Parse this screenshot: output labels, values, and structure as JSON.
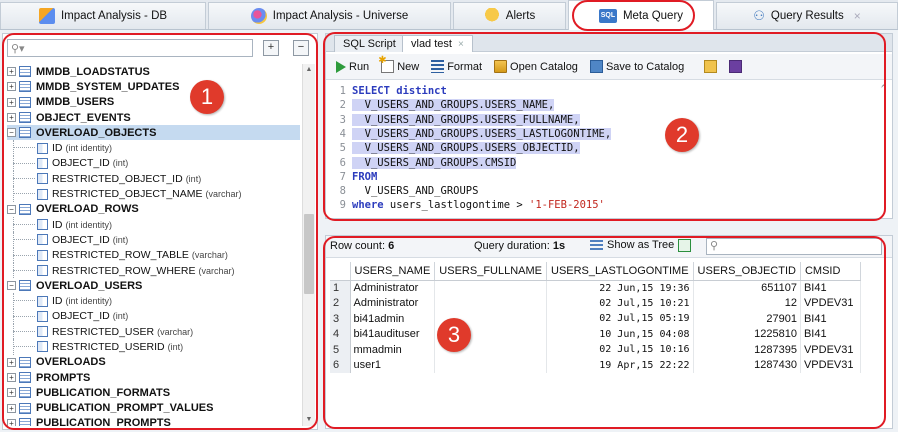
{
  "top_tabs": [
    {
      "label": "Impact Analysis - DB",
      "icon": "impact-analysis-icon"
    },
    {
      "label": "Impact Analysis - Universe",
      "icon": "universe-icon"
    },
    {
      "label": "Alerts",
      "icon": "bell-icon"
    },
    {
      "label": "Meta Query",
      "icon": "sql-icon",
      "icon_text": "SQL",
      "active": true
    },
    {
      "label": "Query Results",
      "icon": "results-icon",
      "close": "×"
    }
  ],
  "left": {
    "search_placeholder": "",
    "expand_all": "+",
    "collapse_all": "−",
    "tree": [
      {
        "type": "table",
        "name": "MMDB_LOADSTATUS"
      },
      {
        "type": "table",
        "name": "MMDB_SYSTEM_UPDATES"
      },
      {
        "type": "table",
        "name": "MMDB_USERS"
      },
      {
        "type": "table",
        "name": "OBJECT_EVENTS"
      },
      {
        "type": "table",
        "name": "OVERLOAD_OBJECTS",
        "selected": true,
        "expanded": true
      },
      {
        "type": "col",
        "name": "ID",
        "dtype": "(int identity)"
      },
      {
        "type": "col",
        "name": "OBJECT_ID",
        "dtype": "(int)"
      },
      {
        "type": "col",
        "name": "RESTRICTED_OBJECT_ID",
        "dtype": "(int)"
      },
      {
        "type": "col",
        "name": "RESTRICTED_OBJECT_NAME",
        "dtype": "(varchar)"
      },
      {
        "type": "table",
        "name": "OVERLOAD_ROWS",
        "expanded": true
      },
      {
        "type": "col",
        "name": "ID",
        "dtype": "(int identity)"
      },
      {
        "type": "col",
        "name": "OBJECT_ID",
        "dtype": "(int)"
      },
      {
        "type": "col",
        "name": "RESTRICTED_ROW_TABLE",
        "dtype": "(varchar)"
      },
      {
        "type": "col",
        "name": "RESTRICTED_ROW_WHERE",
        "dtype": "(varchar)"
      },
      {
        "type": "table",
        "name": "OVERLOAD_USERS",
        "expanded": true
      },
      {
        "type": "col",
        "name": "ID",
        "dtype": "(int identity)"
      },
      {
        "type": "col",
        "name": "OBJECT_ID",
        "dtype": "(int)"
      },
      {
        "type": "col",
        "name": "RESTRICTED_USER",
        "dtype": "(varchar)"
      },
      {
        "type": "col",
        "name": "RESTRICTED_USERID",
        "dtype": "(int)"
      },
      {
        "type": "table",
        "name": "OVERLOADS"
      },
      {
        "type": "table",
        "name": "PROMPTS"
      },
      {
        "type": "table",
        "name": "PUBLICATION_FORMATS"
      },
      {
        "type": "table",
        "name": "PUBLICATION_PROMPT_VALUES"
      },
      {
        "type": "table",
        "name": "PUBLICATION_PROMPTS"
      }
    ]
  },
  "editor": {
    "tabs": [
      {
        "label": "SQL Script",
        "active": false
      },
      {
        "label": "vlad test",
        "active": true,
        "close": "×"
      }
    ],
    "toolbar": {
      "run": "Run",
      "new": "New",
      "format": "Format",
      "open_catalog": "Open Catalog",
      "save_catalog": "Save to Catalog"
    },
    "lines": [
      {
        "n": "1",
        "text": "SELECT distinct",
        "kind": "kw"
      },
      {
        "n": "2",
        "text": "  V_USERS_AND_GROUPS.USERS_NAME,",
        "kind": "hl"
      },
      {
        "n": "3",
        "text": "  V_USERS_AND_GROUPS.USERS_FULLNAME,",
        "kind": "hl"
      },
      {
        "n": "4",
        "text": "  V_USERS_AND_GROUPS.USERS_LASTLOGONTIME,",
        "kind": "hl"
      },
      {
        "n": "5",
        "text": "  V_USERS_AND_GROUPS.USERS_OBJECTID,",
        "kind": "hl"
      },
      {
        "n": "6",
        "text": "  V_USERS_AND_GROUPS.CMSID",
        "kind": "hl"
      },
      {
        "n": "7",
        "text": "FROM",
        "kind": "kw"
      },
      {
        "n": "8",
        "text": "  V_USERS_AND_GROUPS",
        "kind": "plain"
      },
      {
        "n": "9",
        "kw": "where",
        "text": " users_lastlogontime > ",
        "str": "'1-FEB-2015'",
        "kind": "where"
      }
    ]
  },
  "results": {
    "row_count_label": "Row count:",
    "row_count": "6",
    "duration_label": "Query duration:",
    "duration": "1s",
    "show_tree": "Show as Tree",
    "search_placeholder": "",
    "columns": [
      "USERS_NAME",
      "USERS_FULLNAME",
      "USERS_LASTLOGONTIME",
      "USERS_OBJECTID",
      "CMSID"
    ],
    "rows": [
      [
        "1",
        "Administrator",
        "",
        "22 Jun,15 19:36",
        "651107",
        "BI41"
      ],
      [
        "2",
        "Administrator",
        "",
        "02 Jul,15 10:21",
        "12",
        "VPDEV31"
      ],
      [
        "3",
        "bi41admin",
        "",
        "02 Jul,15 05:19",
        "27901",
        "BI41"
      ],
      [
        "4",
        "bi41audituser",
        "",
        "10 Jun,15 04:08",
        "1225810",
        "BI41"
      ],
      [
        "5",
        "mmadmin",
        "",
        "02 Jul,15 10:16",
        "1287395",
        "VPDEV31"
      ],
      [
        "6",
        "user1",
        "",
        "19 Apr,15 22:22",
        "1287430",
        "VPDEV31"
      ]
    ]
  },
  "annotations": [
    "1",
    "2",
    "3"
  ],
  "colors": {
    "annotation": "#e01b24",
    "selection": "#c5daf0",
    "keyword": "#2b3bbd",
    "string": "#c2261d",
    "highlight": "#cfd3f5"
  }
}
